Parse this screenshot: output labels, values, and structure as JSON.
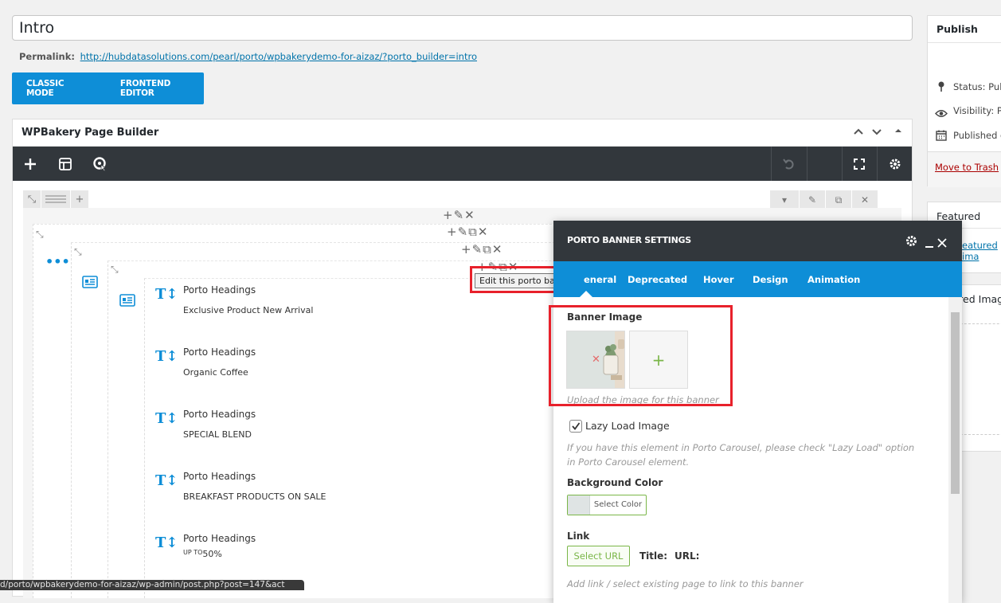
{
  "post": {
    "title": "Intro",
    "permalink_label": "Permalink:",
    "permalink_url": "http://hubdatasolutions.com/pearl/porto/wpbakerydemo-for-aizaz/?porto_builder=intro"
  },
  "modes": {
    "classic": "CLASSIC MODE",
    "frontend": "FRONTEND EDITOR"
  },
  "builder": {
    "title": "WPBakery Page Builder",
    "headings": [
      {
        "name": "Porto Headings",
        "value": "Exclusive Product New Arrival"
      },
      {
        "name": "Porto Headings",
        "value": "Organic Coffee"
      },
      {
        "name": "Porto Headings",
        "value": "SPECIAL BLEND"
      },
      {
        "name": "Porto Headings",
        "value": "BREAKFAST PRODUCTS ON SALE"
      },
      {
        "name": "Porto Headings",
        "value_small": "UP TO",
        "value": "50%"
      }
    ],
    "tooltip": "Edit this porto banner"
  },
  "sidebar": {
    "publish": {
      "title": "Publish",
      "status": "Status: Publ",
      "visibility": "Visibility: Pu",
      "published": "Published o",
      "trash": "Move to Trash"
    },
    "featured": {
      "title": "Featured imag",
      "link": "eatured ima"
    },
    "featured2": {
      "title": "eatured Imag"
    }
  },
  "modal": {
    "title": "PORTO BANNER SETTINGS",
    "tabs": [
      "eneral",
      "Deprecated",
      "Hover",
      "Design",
      "Animation"
    ],
    "banner_image_label": "Banner Image",
    "banner_image_help": "Upload the image for this banner",
    "lazy_label": "Lazy Load Image",
    "lazy_checked": true,
    "lazy_help": "If you have this element in Porto Carousel, please check \"Lazy Load\" option in Porto Carousel element.",
    "bg_label": "Background Color",
    "bg_button": "Select Color",
    "bg_swatch": "#dfe4e4",
    "link_label": "Link",
    "select_url": "Select URL",
    "title_label": "Title:",
    "url_label": "URL:",
    "link_help": "Add link / select existing page to link to this banner"
  },
  "statusbar": "d/porto/wpbakerydemo-for-aizaz/wp-admin/post.php?post=147&act",
  "colors": {
    "accent": "#0e8ed7",
    "dark": "#32373c",
    "highlight": "#e8212b",
    "green": "#7ab648"
  }
}
